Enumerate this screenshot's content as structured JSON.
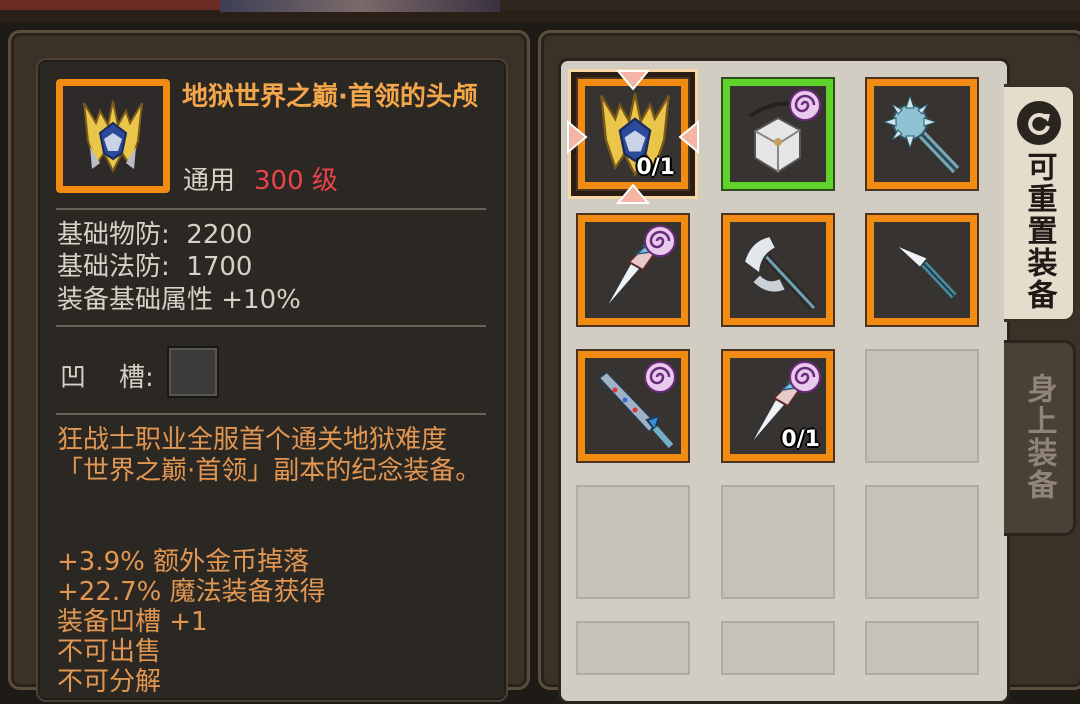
{
  "tooltip": {
    "item_name": "地狱世界之巅·首领的头颅",
    "item_type": "通用",
    "item_level": "300 级",
    "stats": [
      "基础物防:  2200",
      "基础法防:  1700",
      "装备基础属性 +10%"
    ],
    "socket_label": "凹    槽:",
    "description": "狂战士职业全服首个通关地狱难度「世界之巅·首领」副本的纪念装备。",
    "bonuses": [
      "+3.9% 额外金币掉落",
      "+22.7% 魔法装备获得",
      "装备凹槽 +1",
      "不可出售",
      "不可分解"
    ]
  },
  "inventory": {
    "slots": [
      {
        "icon": "golden-helmet-icon",
        "frame": "orange",
        "count": "0/1",
        "selected": true,
        "magic": false
      },
      {
        "icon": "cube-amulet-icon",
        "frame": "green",
        "count": "",
        "selected": false,
        "magic": true
      },
      {
        "icon": "spiked-mace-icon",
        "frame": "orange",
        "count": "",
        "selected": false,
        "magic": false
      },
      {
        "icon": "feather-dagger-icon",
        "frame": "orange",
        "count": "",
        "selected": false,
        "magic": true
      },
      {
        "icon": "battle-axe-icon",
        "frame": "orange",
        "count": "",
        "selected": false,
        "magic": false
      },
      {
        "icon": "spearhead-icon",
        "frame": "orange",
        "count": "",
        "selected": false,
        "magic": false
      },
      {
        "icon": "jeweled-sword-icon",
        "frame": "orange",
        "count": "",
        "selected": false,
        "magic": true
      },
      {
        "icon": "feather-dagger-icon",
        "frame": "orange",
        "count": "0/1",
        "selected": false,
        "magic": true
      }
    ]
  },
  "tabs": {
    "resettable": "可重置装备",
    "equipped": "身上装备"
  },
  "colors": {
    "legendary_frame": "#f28b12",
    "magic_frame": "#5fd32b",
    "item_name": "#f4a64a",
    "level_red": "#e8444a",
    "description": "#e19652"
  }
}
